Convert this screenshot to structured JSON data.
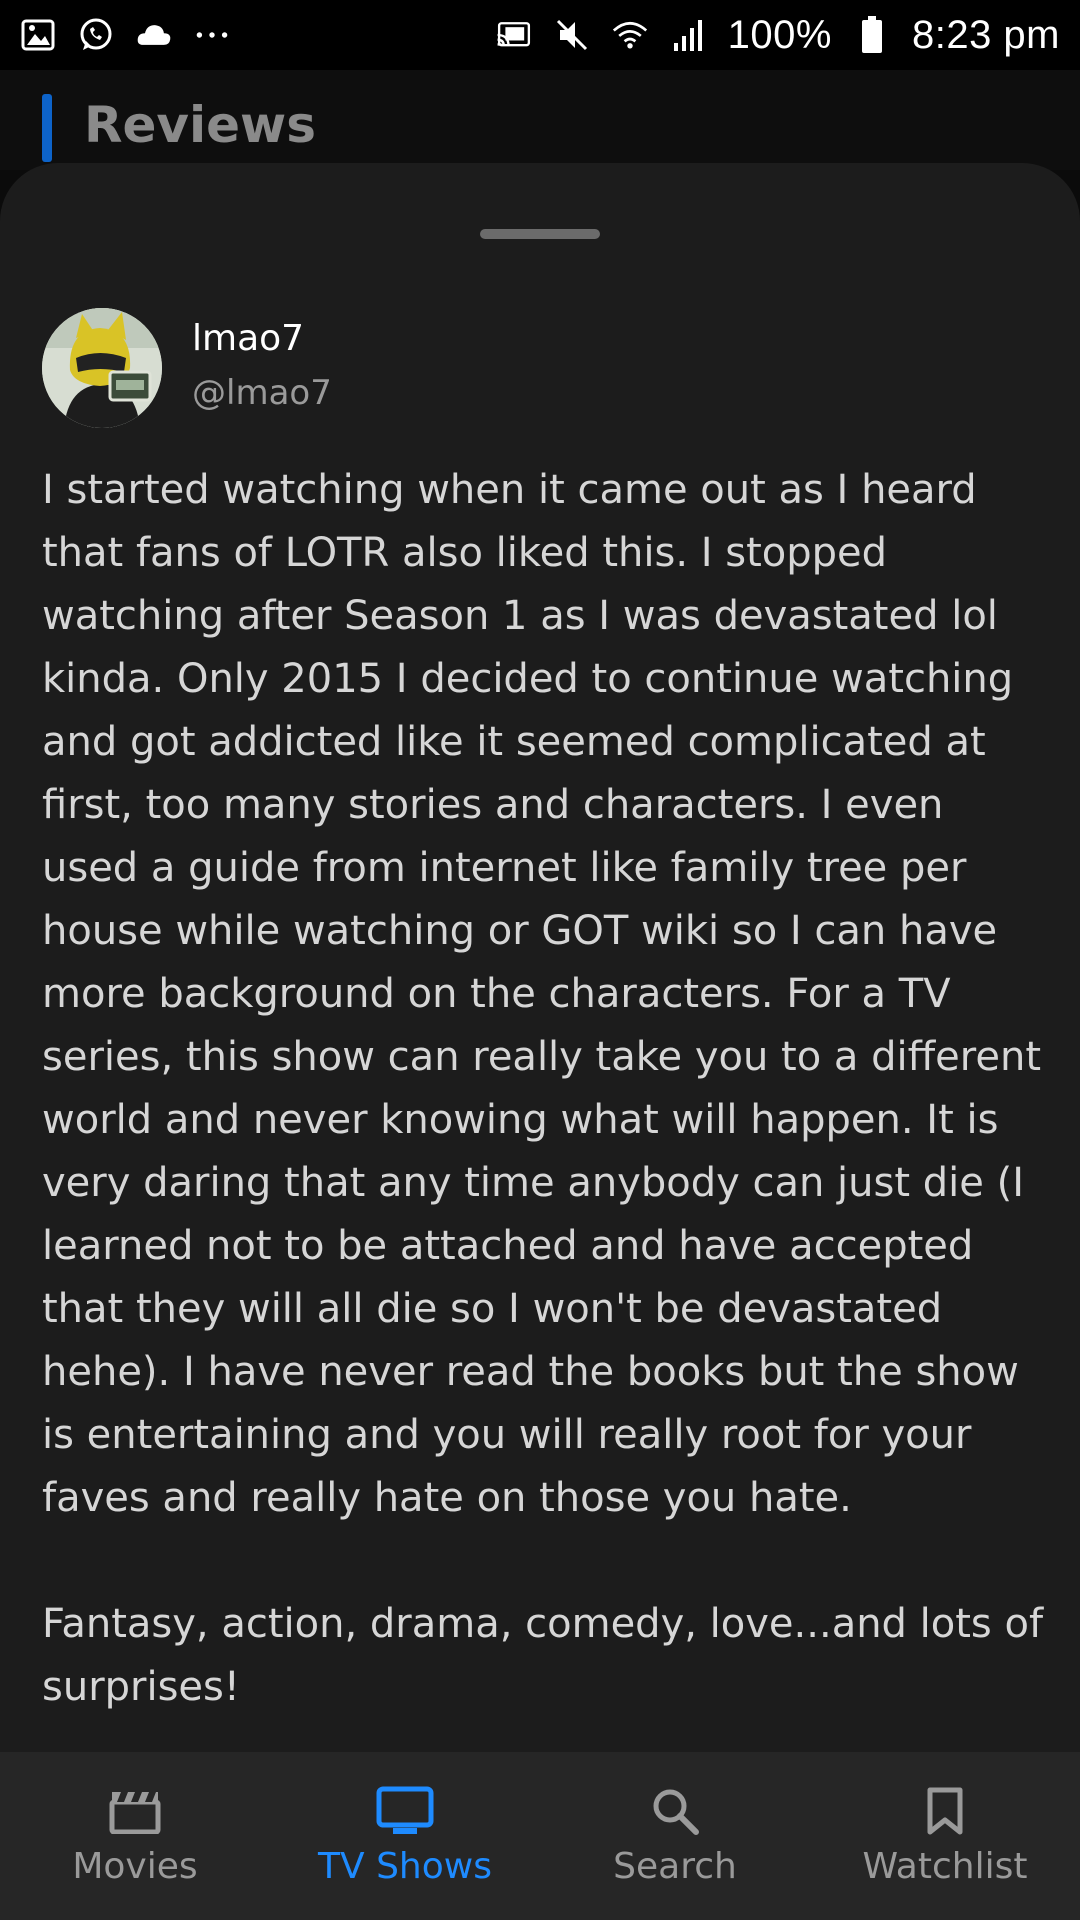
{
  "status_bar": {
    "battery": "100%",
    "time": "8:23 pm",
    "left_icons": [
      "image-icon",
      "whatsapp-icon",
      "cloud-icon",
      "more-icon"
    ],
    "right_icons": [
      "cast-icon",
      "mute-icon",
      "wifi-icon",
      "signal-icon",
      "battery-icon"
    ]
  },
  "section": {
    "title": "Reviews",
    "accent_color": "#0d63c9"
  },
  "review": {
    "author_name": "lmao7",
    "author_handle": "@lmao7",
    "body": "I started watching when it came out as I heard that fans of LOTR also liked this. I stopped watching after Season 1 as I was devastated lol kinda. Only 2015 I decided to continue watching and got addicted like it seemed complicated at first, too many stories and characters. I even used a guide from internet like family tree per house while watching or GOT wiki so I can have more background on the characters. For a TV series, this show can really take you to a different world and never knowing what will happen. It is very daring that any time anybody can just die (I learned not to be attached and have accepted that they will all die so I won't be devastated hehe). I have never read the books but the show is entertaining and you will really root for your faves and really hate on those you hate.\n\nFantasy, action, drama, comedy, love...and lots of surprises!"
  },
  "bottom_nav": {
    "items": [
      {
        "label": "Movies",
        "icon": "clapperboard-icon"
      },
      {
        "label": "TV Shows",
        "icon": "tv-icon"
      },
      {
        "label": "Search",
        "icon": "search-icon"
      },
      {
        "label": "Watchlist",
        "icon": "bookmark-icon"
      }
    ],
    "active_color": "#1e8bff",
    "inactive_color": "#9a9a9a"
  }
}
